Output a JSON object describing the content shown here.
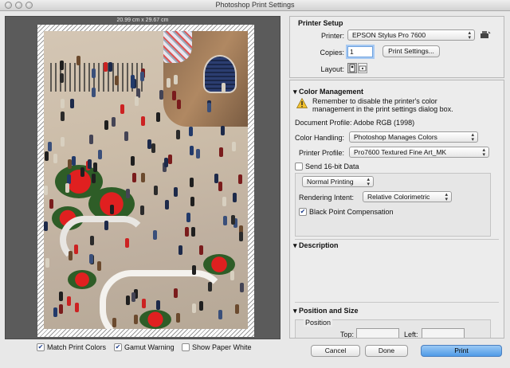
{
  "window": {
    "title": "Photoshop Print Settings"
  },
  "preview": {
    "dimensions_label": "20.99 cm x 29.67 cm"
  },
  "preview_options": {
    "match_print_colors": {
      "label": "Match Print Colors",
      "checked": true
    },
    "gamut_warning": {
      "label": "Gamut Warning",
      "checked": true
    },
    "show_paper_white": {
      "label": "Show Paper White",
      "checked": false
    }
  },
  "printer_setup": {
    "title": "Printer Setup",
    "printer_label": "Printer:",
    "printer_value": "EPSON Stylus Pro 7600",
    "copies_label": "Copies:",
    "copies_value": "1",
    "print_settings_button": "Print Settings...",
    "layout_label": "Layout:"
  },
  "color_management": {
    "title": "Color Management",
    "warning_line1": "Remember to disable the printer's color",
    "warning_line2": "management in the print settings dialog box.",
    "document_profile": "Document Profile: Adobe RGB (1998)",
    "color_handling_label": "Color Handling:",
    "color_handling_value": "Photoshop Manages Colors",
    "printer_profile_label": "Printer Profile:",
    "printer_profile_value": "Pro7600 Textured Fine Art_MK",
    "send_16bit": {
      "label": "Send 16-bit Data",
      "checked": false
    },
    "printing_mode_value": "Normal Printing",
    "rendering_intent_label": "Rendering Intent:",
    "rendering_intent_value": "Relative Colorimetric",
    "black_point": {
      "label": "Black Point Compensation",
      "checked": true
    }
  },
  "description": {
    "title": "Description"
  },
  "position_and_size": {
    "title": "Position and Size",
    "position_group": "Position",
    "top_label": "Top:",
    "top_value": "",
    "left_label": "Left:",
    "left_value": ""
  },
  "footer": {
    "cancel_button": "Cancel",
    "done_button": "Done",
    "print_button": "Print"
  },
  "checkmark_glyph": "✔",
  "colors": {
    "accent_blue": "#4f9ae6",
    "preview_bg": "#5b5b5b",
    "warning_yellow": "#f2c12e"
  }
}
